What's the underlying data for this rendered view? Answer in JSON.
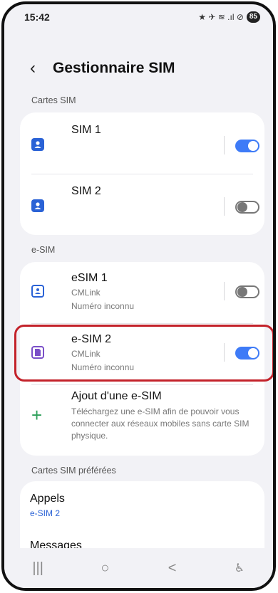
{
  "status_bar": {
    "time": "15:42",
    "icons": "★ ✈ ≋ .ıl ⊘",
    "battery": "85"
  },
  "header": {
    "back_icon": "chevron-left",
    "title": "Gestionnaire SIM"
  },
  "sections": {
    "sim_cards": "Cartes SIM",
    "esim": "e-SIM",
    "preferred": "Cartes SIM préférées"
  },
  "sim_cards": [
    {
      "name": "SIM 1",
      "enabled": true
    },
    {
      "name": "SIM 2",
      "enabled": false
    }
  ],
  "esims": [
    {
      "name": "eSIM 1",
      "carrier": "CMLink",
      "number": "Numéro inconnu",
      "enabled": false
    },
    {
      "name": "e-SIM 2",
      "carrier": "CMLink",
      "number": "Numéro inconnu",
      "enabled": true
    }
  ],
  "add_esim": {
    "title": "Ajout d'une e-SIM",
    "description": "Téléchargez une e-SIM afin de pouvoir vous connecter aux réseaux mobiles sans carte SIM physique.",
    "icon": "+"
  },
  "preferred": {
    "calls_label": "Appels",
    "calls_value": "e-SIM 2",
    "messages_label": "Messages"
  },
  "nav": {
    "recents": "|||",
    "home": "○",
    "back": "<",
    "accessibility": "♿"
  },
  "colors": {
    "accent": "#3e7bf7",
    "sim_icon": "#2a62d6",
    "esim2_icon": "#7a4fc8",
    "highlight": "#c3222a"
  }
}
